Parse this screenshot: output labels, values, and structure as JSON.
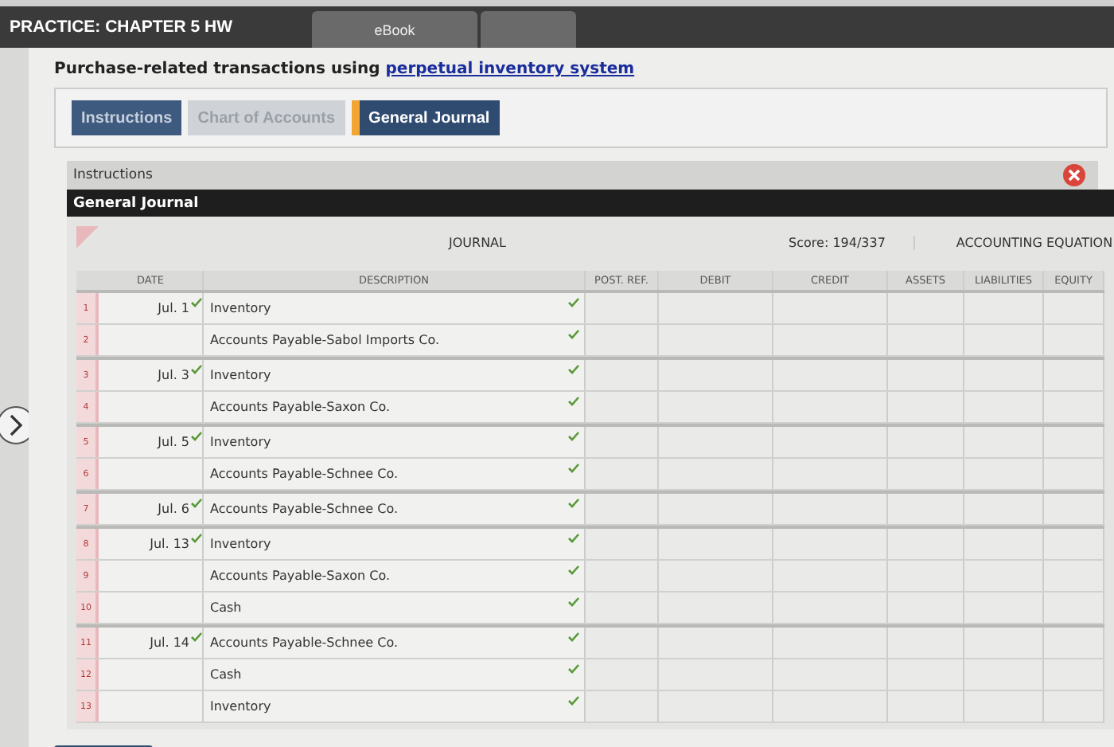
{
  "header": {
    "title": "PRACTICE: CHAPTER 5 HW",
    "tabs": [
      {
        "label": "eBook",
        "selected": false
      },
      {
        "selected": false
      }
    ]
  },
  "question": {
    "text": "Purchase-related transactions using",
    "link": "perpetual inventory system"
  },
  "tabs": [
    {
      "label": "Instructions",
      "selected": false,
      "disabled": false
    },
    {
      "label": "Chart of Accounts",
      "selected": false,
      "disabled": true
    },
    {
      "label": "General Journal",
      "selected": true,
      "disabled": false
    }
  ],
  "panel": {
    "instructions_label": "Instructions",
    "title": "General Journal"
  },
  "journal": {
    "title": "JOURNAL",
    "score": "Score: 194/337",
    "equation_title": "ACCOUNTING EQUATION",
    "columns": [
      "DATE",
      "DESCRIPTION",
      "POST. REF.",
      "DEBIT",
      "CREDIT",
      "ASSETS",
      "LIABILITIES",
      "EQUITY"
    ],
    "entries": [
      {
        "date": "Jul. 1",
        "checked": true,
        "lines": [
          {
            "number": "1",
            "description": "Inventory",
            "checked": true
          },
          {
            "number": "2",
            "description": "Accounts Payable-Sabol Imports Co.",
            "checked": true
          }
        ]
      },
      {
        "date": "Jul. 3",
        "checked": true,
        "lines": [
          {
            "number": "3",
            "description": "Inventory",
            "checked": true
          },
          {
            "number": "4",
            "description": "Accounts Payable-Saxon Co.",
            "checked": true
          }
        ]
      },
      {
        "date": "Jul. 5",
        "checked": true,
        "lines": [
          {
            "number": "5",
            "description": "Inventory",
            "checked": true
          },
          {
            "number": "6",
            "description": "Accounts Payable-Schnee Co.",
            "checked": true
          }
        ]
      },
      {
        "date": "Jul. 6",
        "checked": true,
        "lines": [
          {
            "number": "7",
            "description": "Accounts Payable-Schnee Co.",
            "checked": true
          }
        ]
      },
      {
        "date": "Jul. 13",
        "checked": true,
        "lines": [
          {
            "number": "8",
            "description": "Inventory",
            "checked": true
          },
          {
            "number": "9",
            "description": "Accounts Payable-Saxon Co.",
            "checked": true
          },
          {
            "number": "10",
            "description": "Cash",
            "checked": true
          }
        ]
      },
      {
        "date": "Jul. 14",
        "checked": true,
        "lines": [
          {
            "number": "11",
            "description": "Accounts Payable-Schnee Co.",
            "checked": true
          },
          {
            "number": "12",
            "description": "Cash",
            "checked": true
          },
          {
            "number": "13",
            "description": "Inventory",
            "checked": true
          }
        ]
      }
    ]
  }
}
